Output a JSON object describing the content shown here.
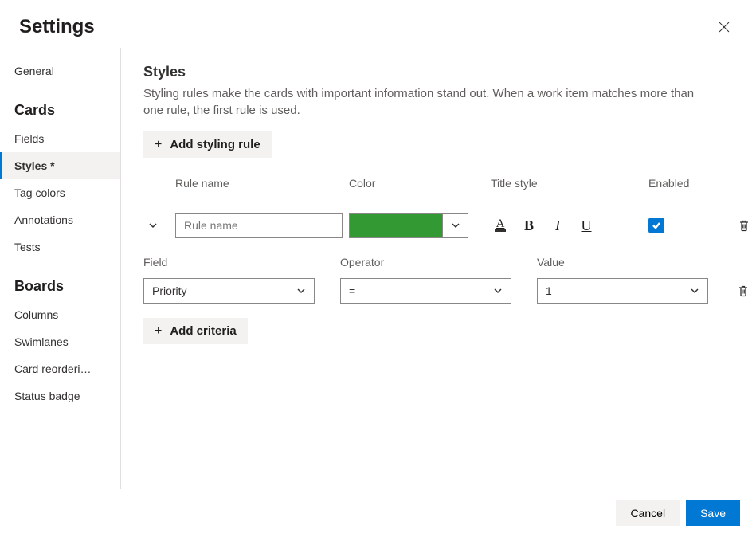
{
  "header": {
    "title": "Settings"
  },
  "sidebar": {
    "items": [
      {
        "label": "General",
        "section": ""
      },
      {
        "label": "Cards",
        "section": "header"
      },
      {
        "label": "Fields",
        "section": ""
      },
      {
        "label": "Styles *",
        "section": "",
        "selected": true
      },
      {
        "label": "Tag colors",
        "section": ""
      },
      {
        "label": "Annotations",
        "section": ""
      },
      {
        "label": "Tests",
        "section": ""
      },
      {
        "label": "Boards",
        "section": "header"
      },
      {
        "label": "Columns",
        "section": ""
      },
      {
        "label": "Swimlanes",
        "section": ""
      },
      {
        "label": "Card reorderi…",
        "section": ""
      },
      {
        "label": "Status badge",
        "section": ""
      }
    ]
  },
  "main": {
    "title": "Styles",
    "description": "Styling rules make the cards with important information stand out. When a work item matches more than one rule, the first rule is used.",
    "add_rule_label": "Add styling rule",
    "columns": {
      "name": "Rule name",
      "color": "Color",
      "title_style": "Title style",
      "enabled": "Enabled"
    },
    "rule": {
      "name_placeholder": "Rule name",
      "name_value": "",
      "color": "#339933",
      "enabled": true
    },
    "criteria_columns": {
      "field": "Field",
      "operator": "Operator",
      "value": "Value"
    },
    "criteria": {
      "field": "Priority",
      "operator": "=",
      "value": "1"
    },
    "add_criteria_label": "Add criteria"
  },
  "footer": {
    "cancel": "Cancel",
    "save": "Save"
  }
}
